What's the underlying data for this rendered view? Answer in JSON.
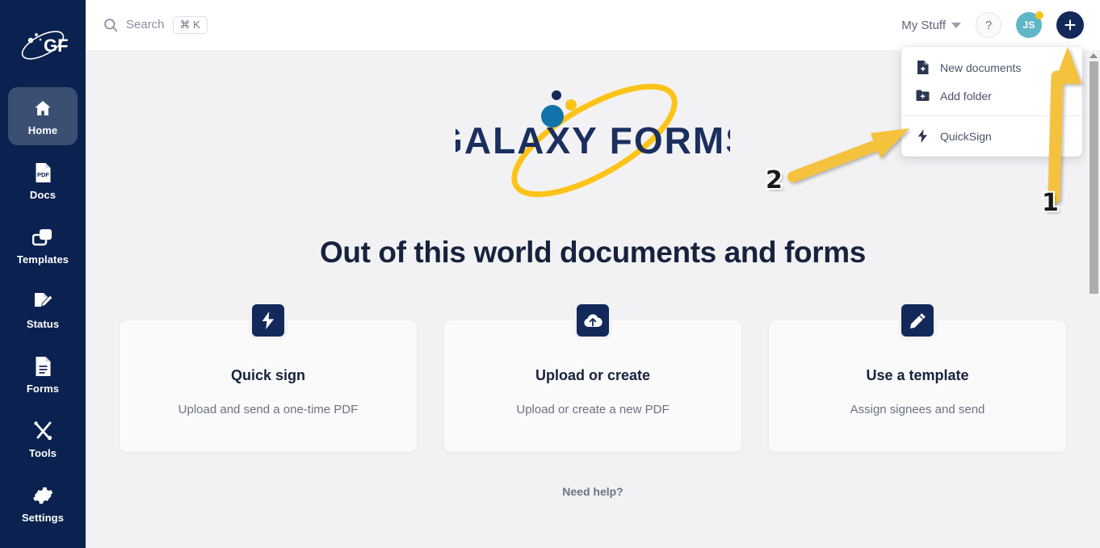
{
  "sidebar": {
    "logo_alt": "GF",
    "items": [
      {
        "label": "Home",
        "icon": "home-icon",
        "active": true
      },
      {
        "label": "Docs",
        "icon": "pdf-file-icon",
        "active": false
      },
      {
        "label": "Templates",
        "icon": "templates-icon",
        "active": false
      },
      {
        "label": "Status",
        "icon": "signature-icon",
        "active": false
      },
      {
        "label": "Forms",
        "icon": "document-icon",
        "active": false
      },
      {
        "label": "Tools",
        "icon": "tools-icon",
        "active": false
      },
      {
        "label": "Settings",
        "icon": "gear-icon",
        "active": false
      }
    ]
  },
  "header": {
    "search_label": "Search",
    "search_shortcut": "⌘ K",
    "my_stuff_label": "My Stuff",
    "help_label": "?",
    "avatar_initials": "JS",
    "plus_label": "+"
  },
  "dropdown": {
    "items": [
      {
        "label": "New documents",
        "icon": "new-document-icon"
      },
      {
        "label": "Add folder",
        "icon": "add-folder-icon"
      },
      {
        "label": "QuickSign",
        "icon": "lightning-bolt-icon"
      }
    ]
  },
  "main": {
    "brand_word_1": "GALAXY",
    "brand_word_2": "FORMS",
    "headline": "Out of this world documents and forms",
    "need_help": "Need help?",
    "cards": [
      {
        "title": "Quick sign",
        "subtitle": "Upload and send a one-time PDF",
        "icon": "lightning-bolt-icon"
      },
      {
        "title": "Upload or create",
        "subtitle": "Upload or create a new PDF",
        "icon": "cloud-upload-icon"
      },
      {
        "title": "Use a template",
        "subtitle": "Assign signees and send",
        "icon": "pencil-icon"
      }
    ]
  },
  "annotations": [
    {
      "number": "1",
      "target": "plus-button"
    },
    {
      "number": "2",
      "target": "quicksign-menu-item"
    }
  ],
  "colors": {
    "sidebar_bg": "#0b2250",
    "sidebar_active": "#3b4f72",
    "brand_navy": "#12295a",
    "brand_yellow": "#fcc419",
    "avatar_teal": "#5fb6c6",
    "page_bg": "#f2f2f4",
    "card_bg": "#fafafb",
    "annotation_yellow": "#f5c23c"
  }
}
